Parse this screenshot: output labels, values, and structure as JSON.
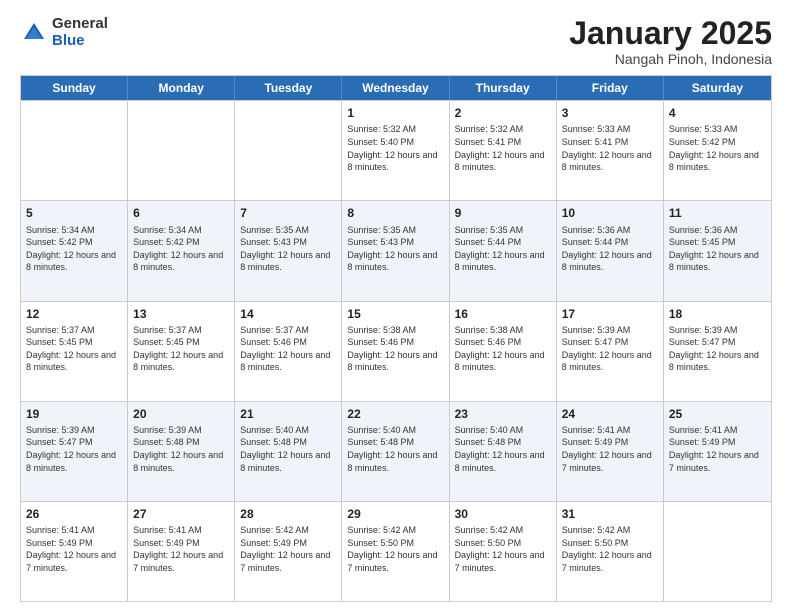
{
  "logo": {
    "general": "General",
    "blue": "Blue"
  },
  "title": {
    "month_year": "January 2025",
    "location": "Nangah Pinoh, Indonesia"
  },
  "weekdays": [
    "Sunday",
    "Monday",
    "Tuesday",
    "Wednesday",
    "Thursday",
    "Friday",
    "Saturday"
  ],
  "rows": [
    [
      {
        "day": "",
        "sunrise": "",
        "sunset": "",
        "daylight": ""
      },
      {
        "day": "",
        "sunrise": "",
        "sunset": "",
        "daylight": ""
      },
      {
        "day": "",
        "sunrise": "",
        "sunset": "",
        "daylight": ""
      },
      {
        "day": "1",
        "sunrise": "Sunrise: 5:32 AM",
        "sunset": "Sunset: 5:40 PM",
        "daylight": "Daylight: 12 hours and 8 minutes."
      },
      {
        "day": "2",
        "sunrise": "Sunrise: 5:32 AM",
        "sunset": "Sunset: 5:41 PM",
        "daylight": "Daylight: 12 hours and 8 minutes."
      },
      {
        "day": "3",
        "sunrise": "Sunrise: 5:33 AM",
        "sunset": "Sunset: 5:41 PM",
        "daylight": "Daylight: 12 hours and 8 minutes."
      },
      {
        "day": "4",
        "sunrise": "Sunrise: 5:33 AM",
        "sunset": "Sunset: 5:42 PM",
        "daylight": "Daylight: 12 hours and 8 minutes."
      }
    ],
    [
      {
        "day": "5",
        "sunrise": "Sunrise: 5:34 AM",
        "sunset": "Sunset: 5:42 PM",
        "daylight": "Daylight: 12 hours and 8 minutes."
      },
      {
        "day": "6",
        "sunrise": "Sunrise: 5:34 AM",
        "sunset": "Sunset: 5:42 PM",
        "daylight": "Daylight: 12 hours and 8 minutes."
      },
      {
        "day": "7",
        "sunrise": "Sunrise: 5:35 AM",
        "sunset": "Sunset: 5:43 PM",
        "daylight": "Daylight: 12 hours and 8 minutes."
      },
      {
        "day": "8",
        "sunrise": "Sunrise: 5:35 AM",
        "sunset": "Sunset: 5:43 PM",
        "daylight": "Daylight: 12 hours and 8 minutes."
      },
      {
        "day": "9",
        "sunrise": "Sunrise: 5:35 AM",
        "sunset": "Sunset: 5:44 PM",
        "daylight": "Daylight: 12 hours and 8 minutes."
      },
      {
        "day": "10",
        "sunrise": "Sunrise: 5:36 AM",
        "sunset": "Sunset: 5:44 PM",
        "daylight": "Daylight: 12 hours and 8 minutes."
      },
      {
        "day": "11",
        "sunrise": "Sunrise: 5:36 AM",
        "sunset": "Sunset: 5:45 PM",
        "daylight": "Daylight: 12 hours and 8 minutes."
      }
    ],
    [
      {
        "day": "12",
        "sunrise": "Sunrise: 5:37 AM",
        "sunset": "Sunset: 5:45 PM",
        "daylight": "Daylight: 12 hours and 8 minutes."
      },
      {
        "day": "13",
        "sunrise": "Sunrise: 5:37 AM",
        "sunset": "Sunset: 5:45 PM",
        "daylight": "Daylight: 12 hours and 8 minutes."
      },
      {
        "day": "14",
        "sunrise": "Sunrise: 5:37 AM",
        "sunset": "Sunset: 5:46 PM",
        "daylight": "Daylight: 12 hours and 8 minutes."
      },
      {
        "day": "15",
        "sunrise": "Sunrise: 5:38 AM",
        "sunset": "Sunset: 5:46 PM",
        "daylight": "Daylight: 12 hours and 8 minutes."
      },
      {
        "day": "16",
        "sunrise": "Sunrise: 5:38 AM",
        "sunset": "Sunset: 5:46 PM",
        "daylight": "Daylight: 12 hours and 8 minutes."
      },
      {
        "day": "17",
        "sunrise": "Sunrise: 5:39 AM",
        "sunset": "Sunset: 5:47 PM",
        "daylight": "Daylight: 12 hours and 8 minutes."
      },
      {
        "day": "18",
        "sunrise": "Sunrise: 5:39 AM",
        "sunset": "Sunset: 5:47 PM",
        "daylight": "Daylight: 12 hours and 8 minutes."
      }
    ],
    [
      {
        "day": "19",
        "sunrise": "Sunrise: 5:39 AM",
        "sunset": "Sunset: 5:47 PM",
        "daylight": "Daylight: 12 hours and 8 minutes."
      },
      {
        "day": "20",
        "sunrise": "Sunrise: 5:39 AM",
        "sunset": "Sunset: 5:48 PM",
        "daylight": "Daylight: 12 hours and 8 minutes."
      },
      {
        "day": "21",
        "sunrise": "Sunrise: 5:40 AM",
        "sunset": "Sunset: 5:48 PM",
        "daylight": "Daylight: 12 hours and 8 minutes."
      },
      {
        "day": "22",
        "sunrise": "Sunrise: 5:40 AM",
        "sunset": "Sunset: 5:48 PM",
        "daylight": "Daylight: 12 hours and 8 minutes."
      },
      {
        "day": "23",
        "sunrise": "Sunrise: 5:40 AM",
        "sunset": "Sunset: 5:48 PM",
        "daylight": "Daylight: 12 hours and 8 minutes."
      },
      {
        "day": "24",
        "sunrise": "Sunrise: 5:41 AM",
        "sunset": "Sunset: 5:49 PM",
        "daylight": "Daylight: 12 hours and 7 minutes."
      },
      {
        "day": "25",
        "sunrise": "Sunrise: 5:41 AM",
        "sunset": "Sunset: 5:49 PM",
        "daylight": "Daylight: 12 hours and 7 minutes."
      }
    ],
    [
      {
        "day": "26",
        "sunrise": "Sunrise: 5:41 AM",
        "sunset": "Sunset: 5:49 PM",
        "daylight": "Daylight: 12 hours and 7 minutes."
      },
      {
        "day": "27",
        "sunrise": "Sunrise: 5:41 AM",
        "sunset": "Sunset: 5:49 PM",
        "daylight": "Daylight: 12 hours and 7 minutes."
      },
      {
        "day": "28",
        "sunrise": "Sunrise: 5:42 AM",
        "sunset": "Sunset: 5:49 PM",
        "daylight": "Daylight: 12 hours and 7 minutes."
      },
      {
        "day": "29",
        "sunrise": "Sunrise: 5:42 AM",
        "sunset": "Sunset: 5:50 PM",
        "daylight": "Daylight: 12 hours and 7 minutes."
      },
      {
        "day": "30",
        "sunrise": "Sunrise: 5:42 AM",
        "sunset": "Sunset: 5:50 PM",
        "daylight": "Daylight: 12 hours and 7 minutes."
      },
      {
        "day": "31",
        "sunrise": "Sunrise: 5:42 AM",
        "sunset": "Sunset: 5:50 PM",
        "daylight": "Daylight: 12 hours and 7 minutes."
      },
      {
        "day": "",
        "sunrise": "",
        "sunset": "",
        "daylight": ""
      }
    ]
  ]
}
